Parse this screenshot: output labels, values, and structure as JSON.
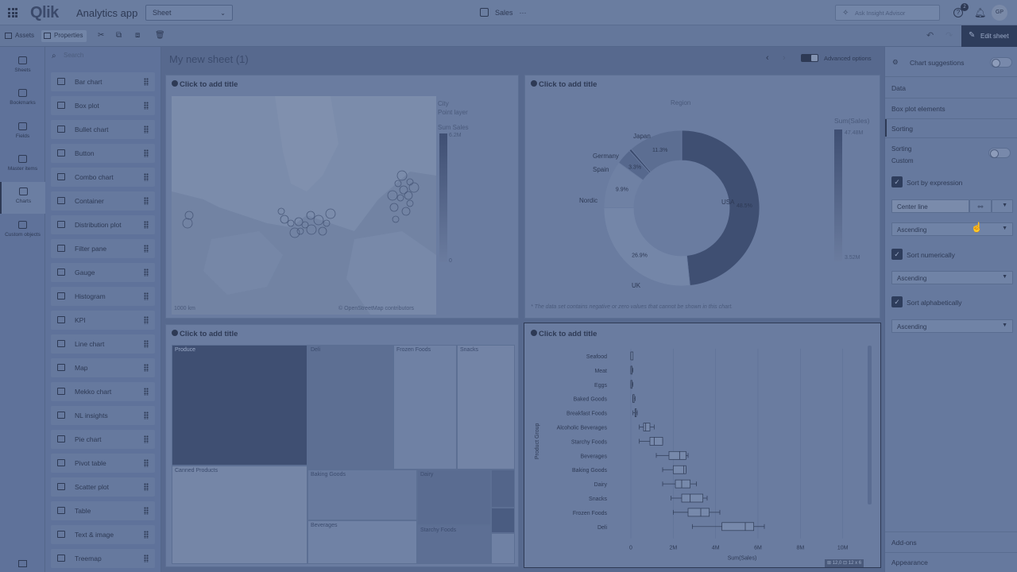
{
  "topbar": {
    "logo": "Qlik",
    "app_title": "Analytics app",
    "sheet_select": "Sheet",
    "center_title": "Sales",
    "center_more": "···",
    "ask_placeholder": "Ask Insight Advisor",
    "help_badge": "2",
    "avatar": "GP"
  },
  "toolbar": {
    "assets": "Assets",
    "properties": "Properties",
    "edit_sheet": "Edit sheet"
  },
  "leftnav": [
    {
      "label": "Sheets",
      "icon": "sheets-icon"
    },
    {
      "label": "Bookmarks",
      "icon": "bookmark-icon"
    },
    {
      "label": "Fields",
      "icon": "database-icon"
    },
    {
      "label": "Master items",
      "icon": "link-icon"
    },
    {
      "label": "Charts",
      "icon": "chart-icon"
    },
    {
      "label": "Custom objects",
      "icon": "puzzle-icon"
    }
  ],
  "chartlist": {
    "search_placeholder": "Search",
    "items": [
      "Bar chart",
      "Box plot",
      "Bullet chart",
      "Button",
      "Combo chart",
      "Container",
      "Distribution plot",
      "Filter pane",
      "Gauge",
      "Histogram",
      "KPI",
      "Line chart",
      "Map",
      "Mekko chart",
      "NL insights",
      "Pie chart",
      "Pivot table",
      "Scatter plot",
      "Table",
      "Text & image",
      "Treemap"
    ]
  },
  "canvas": {
    "sheet_title": "My new sheet (1)",
    "advanced_options": "Advanced options",
    "add_title": "Click to add title"
  },
  "map": {
    "legend_title": "City",
    "legend_sub": "Point layer",
    "measure": "Sum Sales",
    "max": "6.2M",
    "min": "0",
    "scale": "1000 km",
    "credit": "© OpenStreetMap contributors"
  },
  "donut": {
    "legend_title": "Region",
    "measure": "Sum(Sales)",
    "max": "47.48M",
    "min": "3.52M",
    "note": "* The data set contains negative or zero values that cannot be shown in this chart."
  },
  "chart_data": [
    {
      "type": "pie",
      "title": "",
      "dimension": "Region",
      "measure": "Sum(Sales)",
      "categories": [
        "USA",
        "UK",
        "Nordic",
        "Spain",
        "Germany",
        "Japan"
      ],
      "values": [
        48.5,
        26.9,
        9.9,
        3.3,
        0.5,
        11.3
      ],
      "labels": [
        "48.5%",
        "26.9%",
        "9.9%",
        "3.3%",
        "",
        "11.3%"
      ]
    },
    {
      "type": "bar",
      "subtype": "boxplot",
      "title": "",
      "ylabel": "Product Group",
      "xlabel": "Sum(Sales)",
      "xticks": [
        "0",
        "2M",
        "4M",
        "6M",
        "8M",
        "10M"
      ],
      "xlim": [
        0,
        10.5
      ],
      "categories": [
        "Seafood",
        "Meat",
        "Eggs",
        "Baked Goods",
        "Breakfast Foods",
        "Alcoholic Beverages",
        "Starchy Foods",
        "Beverages",
        "Baking Goods",
        "Dairy",
        "Snacks",
        "Frozen Foods",
        "Deli"
      ],
      "series": [
        {
          "name": "min",
          "values": [
            0,
            0,
            0,
            0.1,
            0.1,
            0.4,
            0.4,
            1.2,
            1.5,
            1.5,
            1.9,
            2.0,
            2.9
          ]
        },
        {
          "name": "q1",
          "values": [
            0,
            0,
            0,
            0.1,
            0.2,
            0.6,
            0.9,
            1.8,
            2.0,
            2.1,
            2.4,
            2.7,
            4.3
          ]
        },
        {
          "name": "median",
          "values": [
            0,
            0,
            0,
            0.1,
            0.2,
            0.7,
            1.1,
            2.3,
            2.5,
            2.4,
            2.8,
            3.3,
            5.4
          ]
        },
        {
          "name": "q3",
          "values": [
            0.1,
            0,
            0.05,
            0.15,
            0.25,
            0.9,
            1.5,
            2.6,
            2.6,
            2.8,
            3.4,
            3.7,
            5.8
          ]
        },
        {
          "name": "max",
          "values": [
            0.1,
            0.1,
            0.1,
            0.2,
            0.3,
            1.1,
            1.5,
            2.7,
            2.6,
            3.1,
            3.6,
            4.2,
            6.3
          ]
        }
      ]
    },
    {
      "type": "heatmap",
      "subtype": "treemap",
      "title": "",
      "categories": [
        "Produce",
        "Deli",
        "Frozen Foods",
        "Snacks",
        "Canned Products",
        "Baking Goods",
        "Dairy",
        "Beverages",
        "Starchy Foods"
      ]
    }
  ],
  "rightpanel": {
    "chart_suggestions": "Chart suggestions",
    "data": "Data",
    "box_plot_elements": "Box plot elements",
    "sorting": "Sorting",
    "sorting_label": "Sorting",
    "sorting_value": "Custom",
    "sort_by_expression": "Sort by expression",
    "expression_value": "Center line",
    "ascending": "Ascending",
    "sort_numerically": "Sort numerically",
    "sort_alphabetically": "Sort alphabetically",
    "addons": "Add-ons",
    "appearance": "Appearance"
  },
  "selection_info": "⊞ 12,0 ⊡ 12 x 6"
}
